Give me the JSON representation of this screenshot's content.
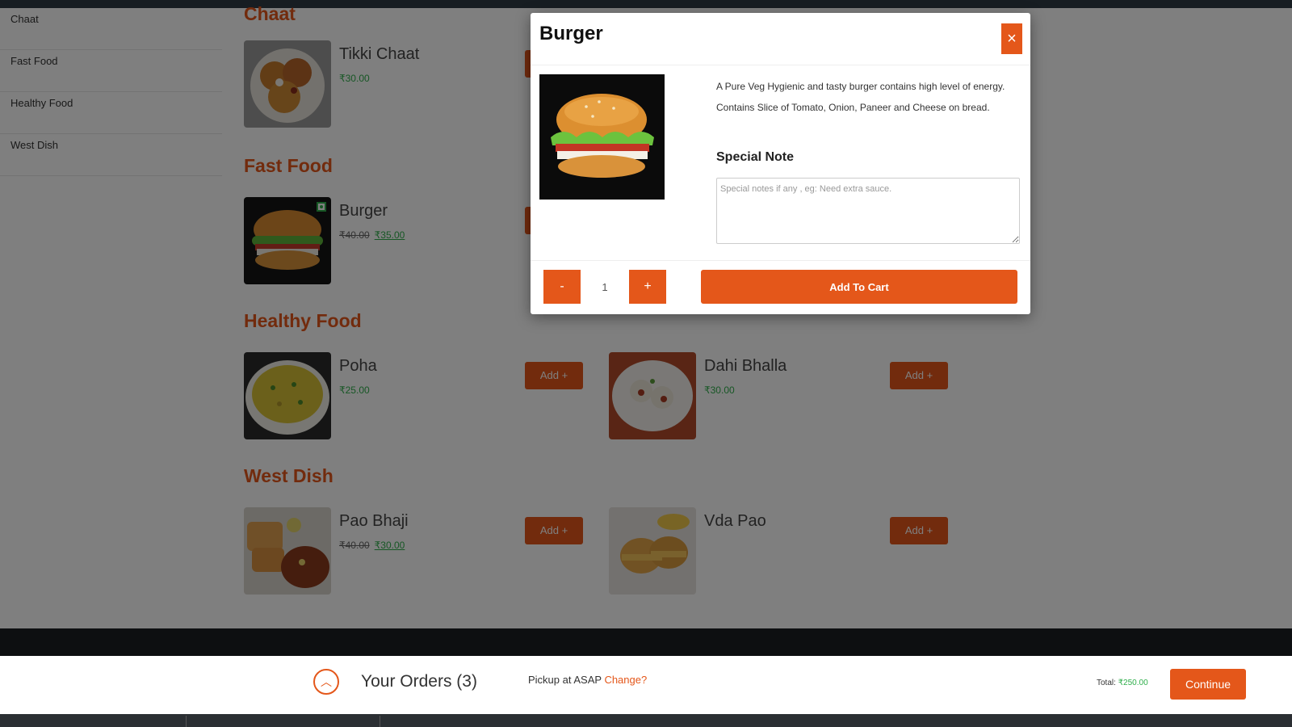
{
  "sidebar": {
    "items": [
      {
        "label": "Chaat"
      },
      {
        "label": "Fast Food"
      },
      {
        "label": "Healthy Food"
      },
      {
        "label": "West Dish"
      }
    ]
  },
  "menu": {
    "add_label": "Add +",
    "categories": [
      {
        "title": "Chaat",
        "items": [
          {
            "name": "Tikki Chaat",
            "price": "₹30.00"
          }
        ]
      },
      {
        "title": "Fast Food",
        "items": [
          {
            "name": "Burger",
            "old_price": "₹40.00",
            "price": "₹35.00"
          }
        ]
      },
      {
        "title": "Healthy Food",
        "items": [
          {
            "name": "Poha",
            "price": "₹25.00"
          },
          {
            "name": "Dahi Bhalla",
            "price": "₹30.00"
          }
        ]
      },
      {
        "title": "West Dish",
        "items": [
          {
            "name": "Pao Bhaji",
            "old_price": "₹40.00",
            "price": "₹30.00"
          },
          {
            "name": "Vda Pao"
          }
        ]
      }
    ]
  },
  "modal": {
    "title": "Burger",
    "close_icon": "×",
    "description": "A Pure Veg Hygienic and tasty burger contains high level of energy. Contains Slice of Tomato, Onion, Paneer and Cheese on bread.",
    "special_note_title": "Special Note",
    "note_placeholder": "Special notes if any , eg: Need extra sauce.",
    "qty_minus": "-",
    "qty_value": "1",
    "qty_plus": "+",
    "add_to_cart": "Add To Cart"
  },
  "footer": {
    "chevron_icon": "︿",
    "orders_label": "Your Orders (3)",
    "pickup_text": "Pickup at ASAP ",
    "change_link": "Change?",
    "total_label": "Total: ",
    "total_amount": "₹250.00",
    "continue_label": "Continue"
  },
  "colors": {
    "accent": "#e4571a",
    "price_green": "#2eae4a"
  }
}
